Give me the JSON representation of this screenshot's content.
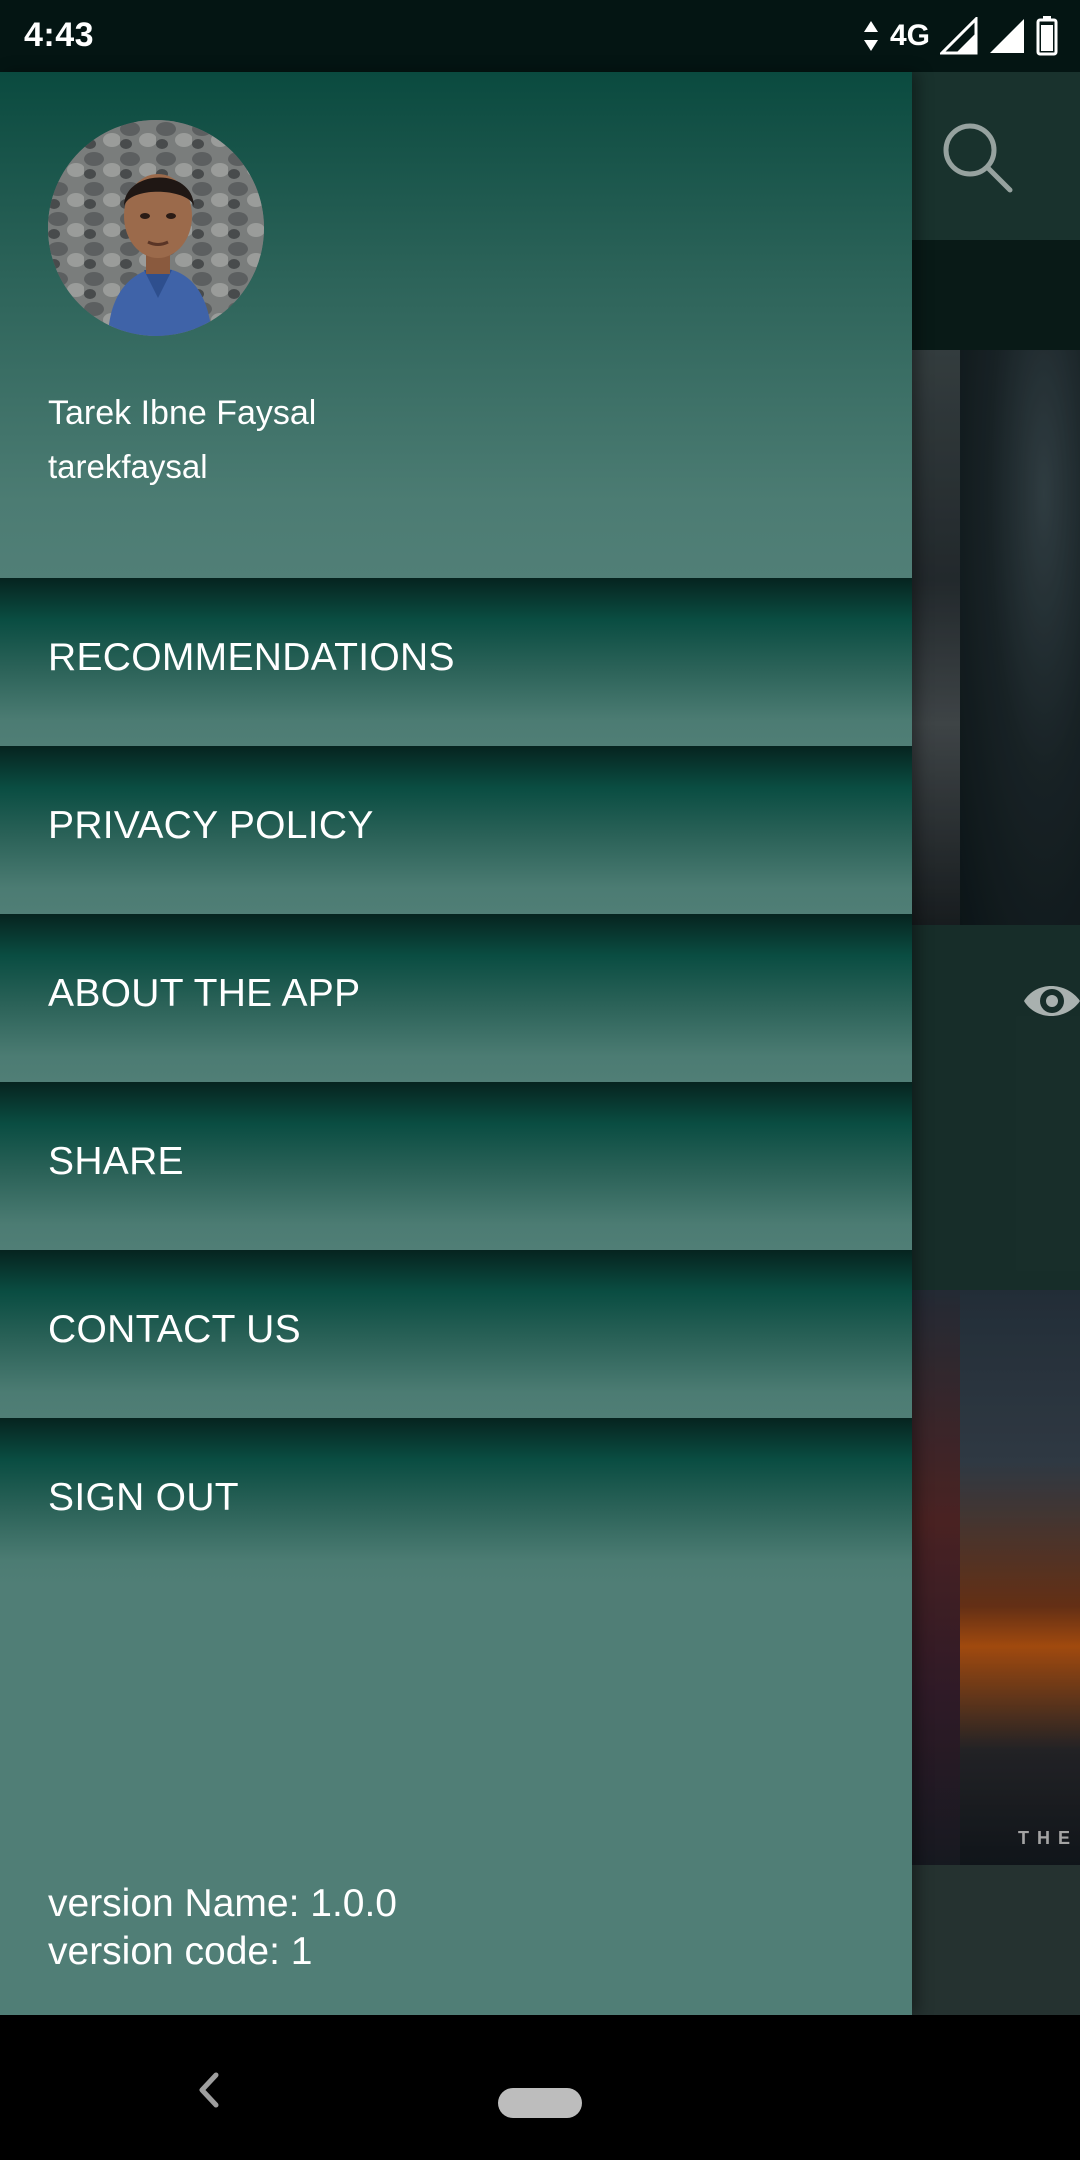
{
  "status_bar": {
    "time": "4:43",
    "network": "4G"
  },
  "drawer": {
    "user": {
      "name": "Tarek Ibne Faysal",
      "handle": "tarekfaysal"
    },
    "menu": [
      {
        "label": "RECOMMENDATIONS"
      },
      {
        "label": "PRIVACY POLICY"
      },
      {
        "label": "ABOUT THE APP"
      },
      {
        "label": "SHARE"
      },
      {
        "label": "CONTACT US"
      },
      {
        "label": "SIGN OUT"
      }
    ],
    "version_name": "version Name: 1.0.0",
    "version_code": "version code: 1"
  },
  "background_app": {
    "poster_caption": "THE"
  },
  "colors": {
    "drawer_teal": "#507e76",
    "drawer_dark": "#0a4d42",
    "status_bar": "#041513"
  },
  "icons": {
    "search": "search-icon",
    "eye": "eye-icon",
    "back": "back-icon",
    "home": "home-pill-icon"
  }
}
